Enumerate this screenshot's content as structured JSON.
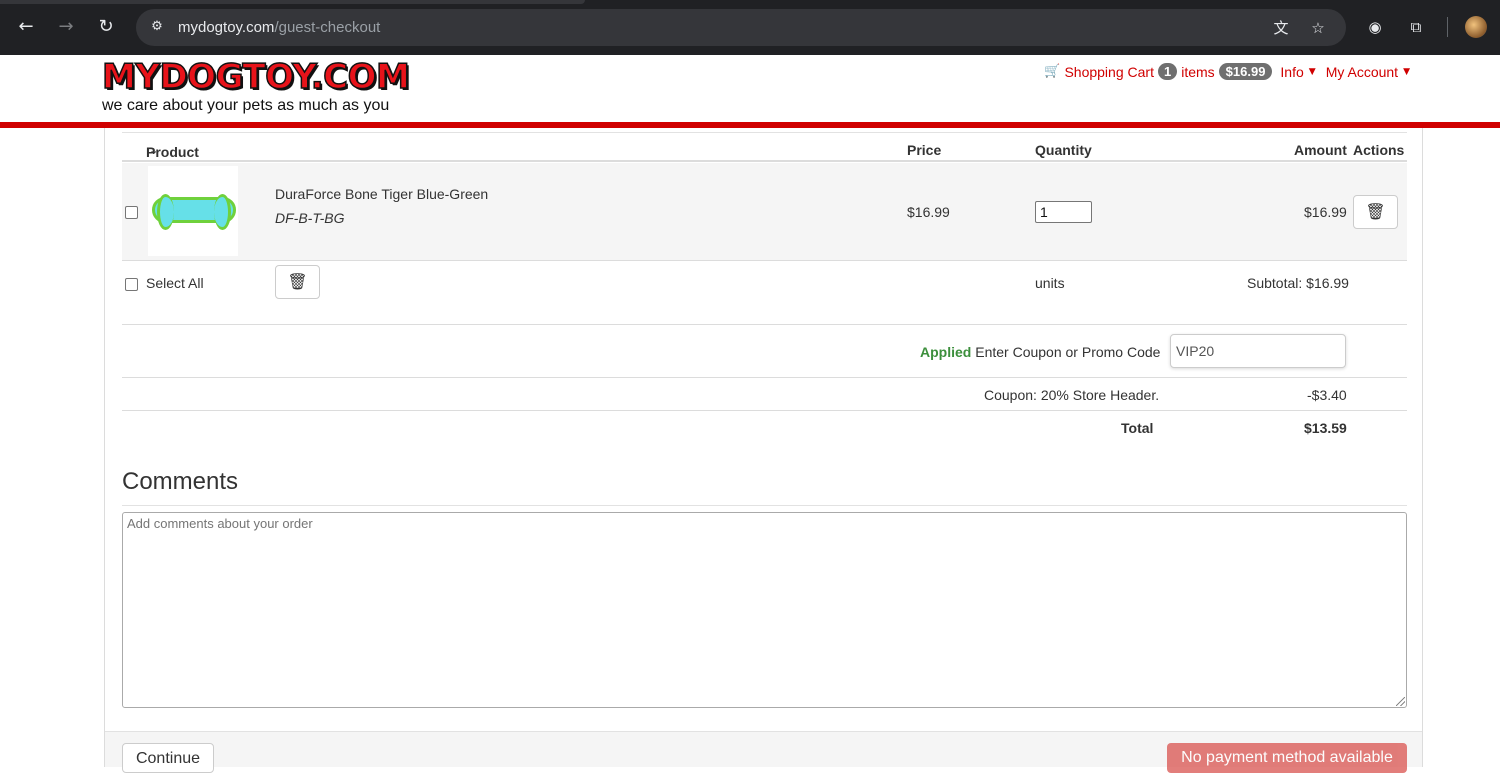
{
  "browser": {
    "url_host": "mydogtoy.com",
    "url_path": "/guest-checkout",
    "icons": [
      "back-icon",
      "forward-icon",
      "reload-icon",
      "site-settings-icon",
      "translate-icon",
      "bookmark-star-icon",
      "extension-icon",
      "puzzle-icon",
      "profile-avatar"
    ]
  },
  "header": {
    "logo_text": "MYDOGTOY.COM",
    "tagline": "we care about your pets as much as you",
    "cart_label": "Shopping Cart",
    "cart_count": "1",
    "items_label": "items",
    "cart_total": "$16.99",
    "info_label": "Info",
    "account_label": "My Account",
    "accent_color": "#d00000"
  },
  "cart": {
    "columns": {
      "product": "Product",
      "price": "Price",
      "quantity": "Quantity",
      "amount": "Amount",
      "actions": "Actions"
    },
    "items": [
      {
        "name": "DuraForce Bone Tiger Blue-Green",
        "sku": "DF-B-T-BG",
        "price": "$16.99",
        "quantity": "1",
        "amount": "$16.99"
      }
    ],
    "select_all_label": "Select All",
    "units_label": "units",
    "subtotal_label": "Subtotal: $16.99",
    "coupon": {
      "status": "Applied",
      "label": "Enter Coupon or Promo Code",
      "value": "VIP20"
    },
    "discount_label": "Coupon: 20% Store Header.",
    "discount_value": "-$3.40",
    "total_label": "Total",
    "total_value": "$13.59"
  },
  "comments": {
    "title": "Comments",
    "placeholder": "Add comments about your order"
  },
  "footer": {
    "continue_label": "Continue",
    "payment_label": "No payment method available"
  }
}
